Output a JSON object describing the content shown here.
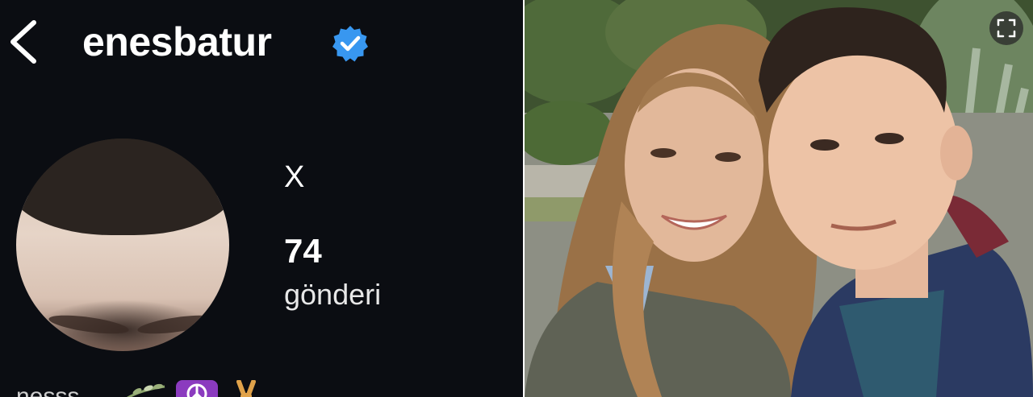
{
  "profile": {
    "username": "enesbatur",
    "verified": true,
    "display_name": "X",
    "posts_count": "74",
    "posts_label": "gönderi",
    "bio_fragment": "nesss"
  },
  "colors": {
    "panel_bg": "#0b0d12",
    "verified_blue": "#3897f0",
    "text": "#ffffff"
  },
  "icons": {
    "back": "chevron-left-icon",
    "verified": "verified-badge-icon",
    "expand": "expand-icon"
  }
}
